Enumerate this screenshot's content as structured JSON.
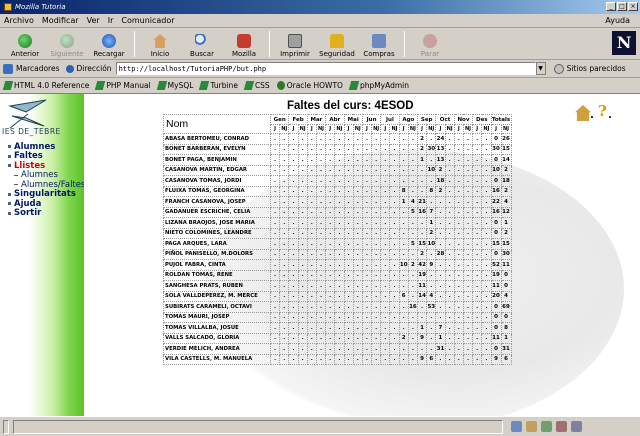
{
  "window": {
    "title": "Mozilla Tutoria"
  },
  "menu": {
    "items": [
      "Archivo",
      "Modificar",
      "Ver",
      "Ir",
      "Comunicador"
    ],
    "help": "Ayuda"
  },
  "toolbar": {
    "back": "Anterior",
    "forward": "Siguiente",
    "reload": "Recargar",
    "home": "Inicio",
    "search": "Buscar",
    "mozilla": "Mozilla",
    "print": "Imprimir",
    "security": "Seguridad",
    "shop": "Compras",
    "stop": "Parar"
  },
  "address": {
    "bookmarks": "Marcadores",
    "label": "Dirección",
    "url": "http://localhost/TutoriaPHP/but.php",
    "related": "Sitios parecidos"
  },
  "personal_bar": [
    "HTML 4.0 Reference",
    "PHP Manual",
    "MySQL",
    "Turbine",
    "CSS",
    "Oracle HOWTO",
    "phpMyAdmin"
  ],
  "sidebar": {
    "logo_text": "IES DE_TEBRE",
    "nav": [
      {
        "label": "Alumnes",
        "state": "normal",
        "level": 0
      },
      {
        "label": "Faltes",
        "state": "normal",
        "level": 0
      },
      {
        "label": "Llistes",
        "state": "active",
        "level": 0
      },
      {
        "label": "Alumnes",
        "state": "normal",
        "level": 1
      },
      {
        "label": "Alumnes/Faltes",
        "state": "normal",
        "level": 1
      },
      {
        "label": "Singularitats",
        "state": "normal",
        "level": 0
      },
      {
        "label": "Ajuda",
        "state": "normal",
        "level": 0
      },
      {
        "label": "Sortir",
        "state": "normal",
        "level": 0
      }
    ]
  },
  "page": {
    "title": "Faltes del curs: 4ESOD",
    "help_glyph": "?",
    "name_header": "Nom",
    "months": [
      "Gen",
      "Feb",
      "Mar",
      "Abr",
      "Mai",
      "Jun",
      "Jul",
      "Ago",
      "Sep",
      "Oct",
      "Nov",
      "Des",
      "Totals"
    ],
    "sub_headers": [
      "J",
      "NJ"
    ],
    "rows": [
      {
        "name": "ABASA BERTOMEU, CONRAD",
        "cells": [
          ".",
          ".",
          ".",
          ".",
          ".",
          ".",
          ".",
          ".",
          ".",
          ".",
          ".",
          ".",
          ".",
          ".",
          ".",
          ".",
          "2",
          ".",
          "24",
          ".",
          ".",
          ".",
          ".",
          ".",
          "0",
          "26"
        ]
      },
      {
        "name": "BONET BARBERAN, EVELYN",
        "cells": [
          ".",
          ".",
          ".",
          ".",
          ".",
          ".",
          ".",
          ".",
          ".",
          ".",
          ".",
          ".",
          ".",
          ".",
          ".",
          ".",
          "2",
          "30",
          "13",
          ".",
          ".",
          ".",
          ".",
          ".",
          "30",
          "15"
        ]
      },
      {
        "name": "BONET PAGA, BENJAMIN",
        "cells": [
          ".",
          ".",
          ".",
          ".",
          ".",
          ".",
          ".",
          ".",
          ".",
          ".",
          ".",
          ".",
          ".",
          ".",
          ".",
          ".",
          "1",
          ".",
          "13",
          ".",
          ".",
          ".",
          ".",
          ".",
          "0",
          "14"
        ]
      },
      {
        "name": "CASANOVA MARTIN, EDGAR",
        "cells": [
          ".",
          ".",
          ".",
          ".",
          ".",
          ".",
          ".",
          ".",
          ".",
          ".",
          ".",
          ".",
          ".",
          ".",
          ".",
          ".",
          ".",
          "10",
          "2",
          ".",
          ".",
          ".",
          ".",
          ".",
          "10",
          "2"
        ]
      },
      {
        "name": "CASANOVA TOMAS, JORDI",
        "cells": [
          ".",
          ".",
          ".",
          ".",
          ".",
          ".",
          ".",
          ".",
          ".",
          ".",
          ".",
          ".",
          ".",
          ".",
          ".",
          ".",
          ".",
          ".",
          "18",
          ".",
          ".",
          ".",
          ".",
          ".",
          "0",
          "18"
        ]
      },
      {
        "name": "FLUIXA TOMAS, GEORGINA",
        "cells": [
          ".",
          ".",
          ".",
          ".",
          ".",
          ".",
          ".",
          ".",
          ".",
          ".",
          ".",
          ".",
          ".",
          ".",
          "8",
          ".",
          ".",
          "8",
          "2",
          ".",
          ".",
          ".",
          ".",
          ".",
          "16",
          "2"
        ]
      },
      {
        "name": "FRANCH CASANOVA, JOSEP",
        "cells": [
          ".",
          ".",
          ".",
          ".",
          ".",
          ".",
          ".",
          ".",
          ".",
          ".",
          ".",
          ".",
          ".",
          ".",
          "1",
          "4",
          "21",
          ".",
          ".",
          ".",
          ".",
          ".",
          ".",
          ".",
          "22",
          "4"
        ]
      },
      {
        "name": "GADANUER ESCRICHE, CELIA",
        "cells": [
          ".",
          ".",
          ".",
          ".",
          ".",
          ".",
          ".",
          ".",
          ".",
          ".",
          ".",
          ".",
          ".",
          ".",
          ".",
          "5",
          "16",
          "7",
          ".",
          ".",
          ".",
          ".",
          ".",
          ".",
          "16",
          "12"
        ]
      },
      {
        "name": "LIZANA BRAOJOS, JOSE MARIA",
        "cells": [
          ".",
          ".",
          ".",
          ".",
          ".",
          ".",
          ".",
          ".",
          ".",
          ".",
          ".",
          ".",
          ".",
          ".",
          ".",
          ".",
          ".",
          "1",
          ".",
          ".",
          ".",
          ".",
          ".",
          ".",
          "0",
          "1"
        ]
      },
      {
        "name": "NIETO COLOMINES, LEANDRE",
        "cells": [
          ".",
          ".",
          ".",
          ".",
          ".",
          ".",
          ".",
          ".",
          ".",
          ".",
          ".",
          ".",
          ".",
          ".",
          ".",
          ".",
          ".",
          "2",
          ".",
          ".",
          ".",
          ".",
          ".",
          ".",
          "0",
          "2"
        ]
      },
      {
        "name": "PAGA ARQUES, LARA",
        "cells": [
          ".",
          ".",
          ".",
          ".",
          ".",
          ".",
          ".",
          ".",
          ".",
          ".",
          ".",
          ".",
          ".",
          ".",
          ".",
          "5",
          "15",
          "10",
          ".",
          ".",
          ".",
          ".",
          ".",
          ".",
          "15",
          "15"
        ]
      },
      {
        "name": "PIÑOL PANISELLO, M.DOLORS",
        "cells": [
          ".",
          ".",
          ".",
          ".",
          ".",
          ".",
          ".",
          ".",
          ".",
          ".",
          ".",
          ".",
          ".",
          ".",
          ".",
          ".",
          "2",
          ".",
          "28",
          ".",
          ".",
          ".",
          ".",
          ".",
          "0",
          "30"
        ]
      },
      {
        "name": "PUJOL FABRA, CINTA",
        "cells": [
          ".",
          ".",
          ".",
          ".",
          ".",
          ".",
          ".",
          ".",
          ".",
          ".",
          ".",
          ".",
          ".",
          ".",
          "10",
          "2",
          "42",
          "9",
          ".",
          ".",
          ".",
          ".",
          ".",
          ".",
          "52",
          "11"
        ]
      },
      {
        "name": "ROLDAN TOMAS, RENE",
        "cells": [
          ".",
          ".",
          ".",
          ".",
          ".",
          ".",
          ".",
          ".",
          ".",
          ".",
          ".",
          ".",
          ".",
          ".",
          ".",
          ".",
          "19",
          ".",
          ".",
          ".",
          ".",
          ".",
          ".",
          ".",
          "19",
          "0"
        ]
      },
      {
        "name": "SANGHESA PRATS, RUBEN",
        "cells": [
          ".",
          ".",
          ".",
          ".",
          ".",
          ".",
          ".",
          ".",
          ".",
          ".",
          ".",
          ".",
          ".",
          ".",
          ".",
          ".",
          "11",
          ".",
          ".",
          ".",
          ".",
          ".",
          ".",
          ".",
          "11",
          "0"
        ]
      },
      {
        "name": "SOLA VALLDEPEREZ, M. MERCE",
        "cells": [
          ".",
          ".",
          ".",
          ".",
          ".",
          ".",
          ".",
          ".",
          ".",
          ".",
          ".",
          ".",
          ".",
          ".",
          "6",
          ".",
          "14",
          "4",
          ".",
          ".",
          ".",
          ".",
          ".",
          ".",
          "20",
          "4"
        ]
      },
      {
        "name": "SUBIRATS CARAMELI, OCTAVI",
        "cells": [
          ".",
          ".",
          ".",
          ".",
          ".",
          ".",
          ".",
          ".",
          ".",
          ".",
          ".",
          ".",
          ".",
          ".",
          ".",
          "16",
          ".",
          "53",
          ".",
          ".",
          ".",
          ".",
          ".",
          ".",
          "0",
          "69"
        ]
      },
      {
        "name": "TOMAS MAURI, JOSEP",
        "cells": [
          ".",
          ".",
          ".",
          ".",
          ".",
          ".",
          ".",
          ".",
          ".",
          ".",
          ".",
          ".",
          ".",
          ".",
          ".",
          ".",
          ".",
          ".",
          ".",
          ".",
          ".",
          ".",
          ".",
          ".",
          "0",
          "0"
        ]
      },
      {
        "name": "TOMAS VILLALBA, JOSUE",
        "cells": [
          ".",
          ".",
          ".",
          ".",
          ".",
          ".",
          ".",
          ".",
          ".",
          ".",
          ".",
          ".",
          ".",
          ".",
          ".",
          ".",
          "1",
          ".",
          "7",
          ".",
          ".",
          ".",
          ".",
          ".",
          "0",
          "8"
        ]
      },
      {
        "name": "VALLS SALCADO, GLORIA",
        "cells": [
          ".",
          ".",
          ".",
          ".",
          ".",
          ".",
          ".",
          ".",
          ".",
          ".",
          ".",
          ".",
          ".",
          ".",
          "2",
          ".",
          "9",
          ".",
          "1",
          ".",
          ".",
          ".",
          ".",
          ".",
          "11",
          "1"
        ]
      },
      {
        "name": "VERDIE MELICH, ANDREA",
        "cells": [
          ".",
          ".",
          ".",
          ".",
          ".",
          ".",
          ".",
          ".",
          ".",
          ".",
          ".",
          ".",
          ".",
          ".",
          ".",
          ".",
          ".",
          ".",
          "31",
          ".",
          ".",
          ".",
          ".",
          ".",
          "0",
          "31"
        ]
      },
      {
        "name": "VILA CASTELLS, M. MANUELA",
        "cells": [
          ".",
          ".",
          ".",
          ".",
          ".",
          ".",
          ".",
          ".",
          ".",
          ".",
          ".",
          ".",
          ".",
          ".",
          ".",
          ".",
          "9",
          "6",
          ".",
          ".",
          ".",
          ".",
          ".",
          ".",
          "9",
          "6"
        ]
      }
    ]
  },
  "colors": {
    "sidebar_green": "#5cc22a",
    "nav_text": "#001a60",
    "nav_active": "#d00000",
    "chrome": "#d4d0c8"
  }
}
